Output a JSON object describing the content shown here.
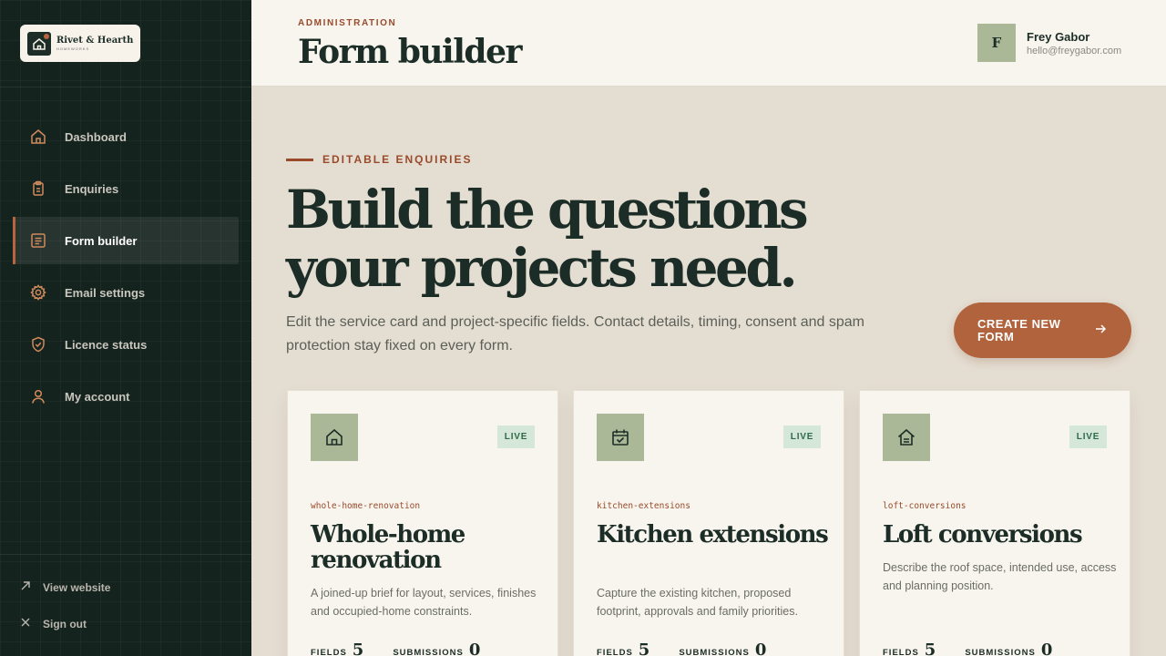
{
  "brand": {
    "name": "Rivet & Hearth",
    "sub": "HOMEWORKS"
  },
  "sidebar": {
    "items": [
      {
        "label": "Dashboard",
        "icon": "home-icon",
        "active": false
      },
      {
        "label": "Enquiries",
        "icon": "clipboard-icon",
        "active": false
      },
      {
        "label": "Form builder",
        "icon": "form-icon",
        "active": true
      },
      {
        "label": "Email settings",
        "icon": "gear-icon",
        "active": false
      },
      {
        "label": "Licence status",
        "icon": "shield-check-icon",
        "active": false
      },
      {
        "label": "My account",
        "icon": "user-icon",
        "active": false
      }
    ],
    "footer": {
      "view_website": "View website",
      "sign_out": "Sign out"
    }
  },
  "header": {
    "eyebrow": "ADMINISTRATION",
    "title": "Form builder",
    "user": {
      "initial": "F",
      "name": "Frey Gabor",
      "email": "hello@freygabor.com"
    }
  },
  "main": {
    "eyebrow": "EDITABLE ENQUIRIES",
    "headline_line1": "Build the questions",
    "headline_line2": "your projects need.",
    "lede": "Edit the service card and project-specific fields. Contact details, timing, consent and spam protection stay fixed on every form.",
    "cta_label": "CREATE NEW FORM",
    "cards": [
      {
        "icon": "home-icon",
        "badge": "LIVE",
        "slug": "whole-home-renovation",
        "title": "Whole-home renovation",
        "desc": "A joined-up brief for layout, services, finishes and occupied-home constraints.",
        "fields_label": "FIELDS",
        "fields": "5",
        "subs_label": "SUBMISSIONS",
        "subs": "0"
      },
      {
        "icon": "calendar-check-icon",
        "badge": "LIVE",
        "slug": "kitchen-extensions",
        "title": "Kitchen extensions",
        "desc": "Capture the existing kitchen, proposed footprint, approvals and family priorities.",
        "fields_label": "FIELDS",
        "fields": "5",
        "subs_label": "SUBMISSIONS",
        "subs": "0"
      },
      {
        "icon": "loft-house-icon",
        "badge": "LIVE",
        "slug": "loft-conversions",
        "title": "Loft conversions",
        "desc": "Describe the roof space, intended use, access and planning position.",
        "fields_label": "FIELDS",
        "fields": "5",
        "subs_label": "SUBMISSIONS",
        "subs": "0"
      }
    ]
  },
  "colors": {
    "sidebar": "#15231f",
    "accent": "#b0633d",
    "sage": "#aab898",
    "live_badge": "#d5e7d9"
  }
}
